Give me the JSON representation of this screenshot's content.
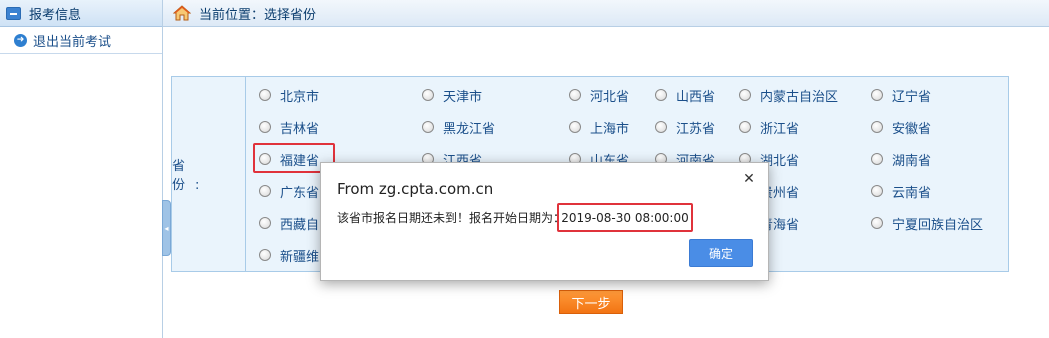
{
  "sidebar": {
    "header_label": "报考信息",
    "items": [
      {
        "label": "退出当前考试"
      }
    ]
  },
  "topbar": {
    "location": "当前位置：选择省份"
  },
  "form": {
    "field_label": "省 份:",
    "provinces": [
      "北京市",
      "天津市",
      "河北省",
      "山西省",
      "内蒙古自治区",
      "辽宁省",
      "吉林省",
      "黑龙江省",
      "上海市",
      "江苏省",
      "浙江省",
      "安徽省",
      "福建省",
      "江西省",
      "山东省",
      "河南省",
      "湖北省",
      "湖南省",
      "广东省",
      "",
      "",
      "",
      "贵州省",
      "云南省",
      "西藏自",
      "",
      "",
      "",
      "青海省",
      "宁夏回族自治区",
      "新疆维"
    ],
    "highlighted": "福建省",
    "next_label": "下一步"
  },
  "dialog": {
    "title": "From zg.cpta.com.cn",
    "message": "该省市报名日期还未到！报名开始日期为：",
    "date": "2019-08-30 08:00:00",
    "ok_label": "确定",
    "close_icon": "close-icon"
  },
  "colors": {
    "accent": "#4a8de6",
    "highlight": "#e0323b",
    "next_button": "#f27413"
  }
}
